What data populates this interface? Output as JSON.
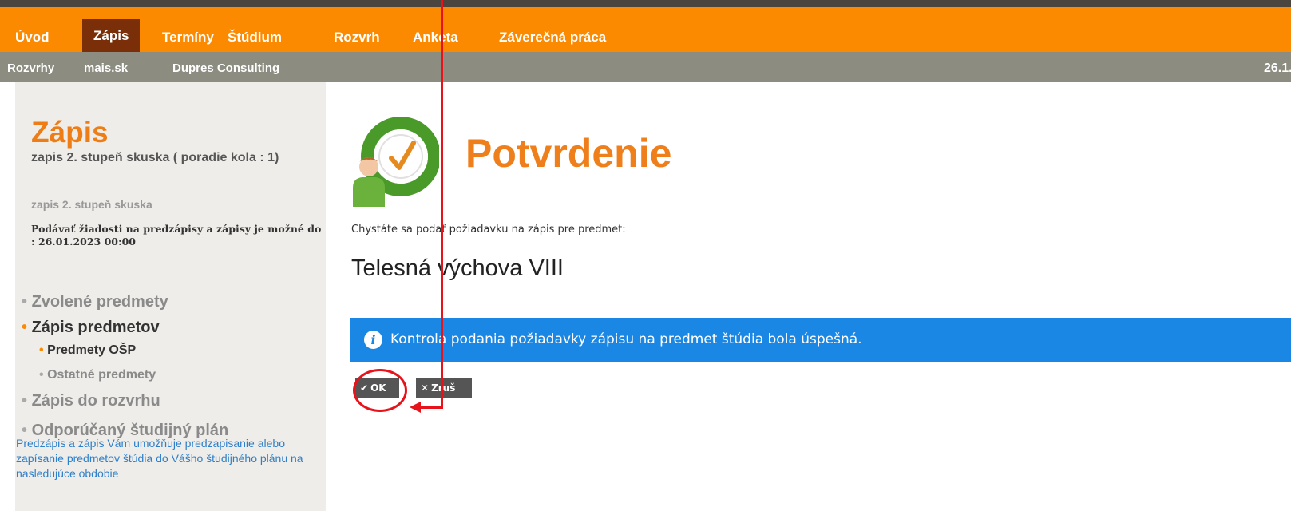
{
  "main_nav": {
    "items": [
      {
        "label": "Úvod"
      },
      {
        "label": "Zápis"
      },
      {
        "label": "Termíny"
      },
      {
        "label": "Štúdium"
      },
      {
        "label": "Rozvrh"
      },
      {
        "label": "Anketa"
      },
      {
        "label": "Záverečná práca"
      }
    ],
    "active_index": 1
  },
  "sub_nav": {
    "items": [
      {
        "label": "Rozvrhy"
      },
      {
        "label": "mais.sk"
      },
      {
        "label": "Dupres Consulting"
      }
    ],
    "date_visible": "26.1."
  },
  "sidebar": {
    "title": "Zápis",
    "subtitle": "zapis 2. stupeň skuska ( poradie kola : 1)",
    "subtitle2": "zapis 2. stupeň skuska",
    "deadline": "Podávať žiadosti na predzápisy a zápisy je možné do : 26.01.2023 00:00",
    "menu": [
      {
        "label": "Zvolené predmety"
      },
      {
        "label": "Zápis predmetov"
      },
      {
        "label": "Predmety OŠP"
      },
      {
        "label": "Ostatné predmety"
      },
      {
        "label": "Zápis do rozvrhu"
      },
      {
        "label": "Odporúčaný študijný plán"
      }
    ],
    "description": "Predzápis a zápis Vám umožňuje predzapisanie alebo zapísanie predmetov štúdia do Vášho študijného plánu na nasledujúce obdobie"
  },
  "main": {
    "title": "Potvrdenie",
    "intro": "Chystáte sa podať požiadavku na zápis pre predmet:",
    "course": "Telesná výchova VIII",
    "alert": "Kontrola podania požiadavky zápisu na predmet štúdia bola úspešná.",
    "ok_label": "OK",
    "cancel_label": "Zruš"
  },
  "colors": {
    "nav_orange": "#fb8a00",
    "nav_active": "#7a2f08",
    "title_orange": "#ef7f1a",
    "alert_blue": "#1a87e4",
    "annotation_red": "#e8121a"
  },
  "icons": {
    "logo": "clock-person-icon",
    "alert": "info-icon",
    "ok": "check-icon",
    "cancel": "close-icon"
  }
}
